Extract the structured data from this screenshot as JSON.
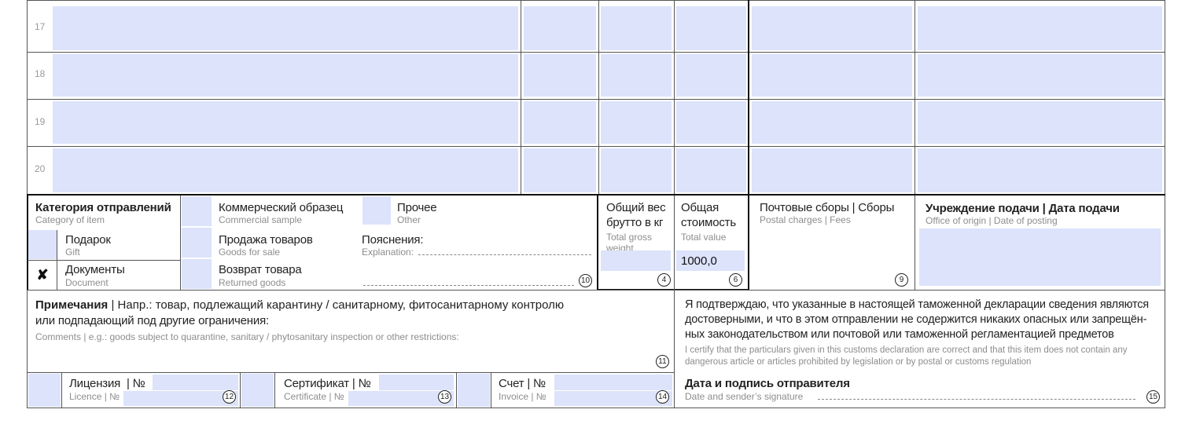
{
  "rows": [
    "17",
    "18",
    "19",
    "20"
  ],
  "category": {
    "title_ru": "Категория отправлений",
    "title_en": "Category of item",
    "gift_ru": "Подарок",
    "gift_en": "Gift",
    "doc_ru": "Документы",
    "doc_en": "Document",
    "doc_mark": "✘",
    "sample_ru": "Коммерческий образец",
    "sample_en": "Commercial sample",
    "sale_ru": "Продажа товаров",
    "sale_en": "Goods for sale",
    "return_ru": "Возврат товара",
    "return_en": "Returned goods",
    "other_ru": "Прочее",
    "other_en": "Other",
    "explain_ru": "Пояснения:",
    "explain_en": "Explanation:",
    "num": "10"
  },
  "weight": {
    "ru1": "Общий вес",
    "ru2": "брутто в кг",
    "en1": "Total gross",
    "en2": "weight",
    "num": "4"
  },
  "value": {
    "ru1": "Общая",
    "ru2": "стоимость",
    "en": "Total value",
    "amount": "1000,0",
    "num": "6"
  },
  "postal": {
    "ru": "Почтовые сборы | Сборы",
    "en": "Postal charges | Fees",
    "num": "9"
  },
  "office": {
    "ru": "Учреждение подачи | Дата подачи",
    "en": "Office of origin | Date of posting"
  },
  "comments": {
    "ru_bold": "Примечания",
    "ru_line1": " | Напр.: товар, подлежащий карантину / санитарному, фитосанитарному контролю",
    "ru_line2": "или подпадающий под другие ограничения:",
    "en": "Comments | e.g.: goods subject to quarantine, sanitary / phytosanitary inspection or other restrictions:",
    "num": "11"
  },
  "certify": {
    "ru1": "Я подтверждаю, что указанные в настоящей таможенной декларации сведения являются",
    "ru2": "достоверными, и что в этом отправлении не содержится никаких опасных или запрещён-",
    "ru3": "ных законодательством или почтовой или таможенной регламентацией предметов",
    "en1": "I certify that the particulars given in this customs declaration are correct and that this item does not contain any",
    "en2": "dangerous article or articles prohibited by legislation or by postal or customs regulation"
  },
  "licence": {
    "ru": "Лицензия  | №",
    "en": "Licence | №",
    "num": "12"
  },
  "certificate": {
    "ru": "Сертификат | №",
    "en": "Certificate | №",
    "num": "13"
  },
  "invoice": {
    "ru": "Счет | №",
    "en": "Invoice | №",
    "num": "14"
  },
  "signature": {
    "ru": "Дата и подпись отправителя",
    "en": "Date and sender’s signature",
    "num": "15"
  }
}
